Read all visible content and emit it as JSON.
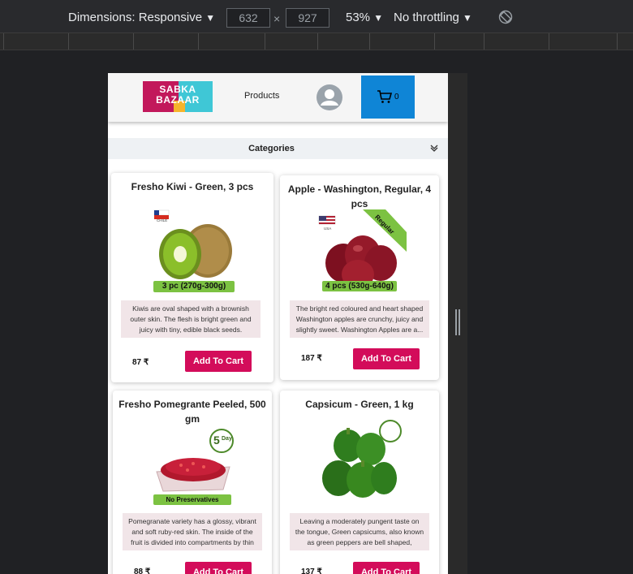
{
  "devtools": {
    "dimensions_label": "Dimensions: Responsive",
    "width_value": "632",
    "height_value": "927",
    "times_symbol": "×",
    "zoom": "53%",
    "throttling": "No throttling",
    "dropdown_glyph": "▼"
  },
  "header": {
    "logo_line1": "SABKA",
    "logo_line2": "BAZAAR",
    "nav_products": "Products",
    "cart_count": "0"
  },
  "categories": {
    "label": "Categories"
  },
  "products": [
    {
      "title": "Fresho Kiwi - Green, 3 pcs",
      "flag_label": "CHILE",
      "pack_label": "3 pc (270g-300g)",
      "description": "Kiwis are oval shaped with a brownish outer skin. The flesh is bright green and juicy with tiny, edible black seeds.",
      "price": "87 ₹",
      "button": "Add To Cart"
    },
    {
      "title": "Apple - Washington, Regular, 4 pcs",
      "flag_label": "USA",
      "ribbon_label": "Regular",
      "pack_label": "4 pcs (530g-640g)",
      "description": "The bright red coloured and heart shaped Washington apples are crunchy, juicy and slightly sweet. Washington Apples are a...",
      "price": "187 ₹",
      "button": "Add To Cart"
    },
    {
      "title": "Fresho Pomegrante Peeled, 500 gm",
      "badge_label_1": "5",
      "badge_label_2": "Day",
      "pack_label": "No Preservatives",
      "description": "Pomegranate variety has a glossy, vibrant and soft ruby-red skin. The inside of the fruit is divided into compartments by thin white...",
      "price": "88 ₹",
      "button": "Add To Cart"
    },
    {
      "title": "Capsicum - Green, 1 kg",
      "description": "Leaving a moderately pungent taste on the tongue, Green capsicums, also known as green peppers are bell shaped, medium-...",
      "price": "137 ₹",
      "button": "Add To Cart"
    }
  ],
  "colors": {
    "accent_pink": "#d30c5a",
    "cart_blue": "#0f85d6",
    "pack_green": "#7cc242"
  }
}
